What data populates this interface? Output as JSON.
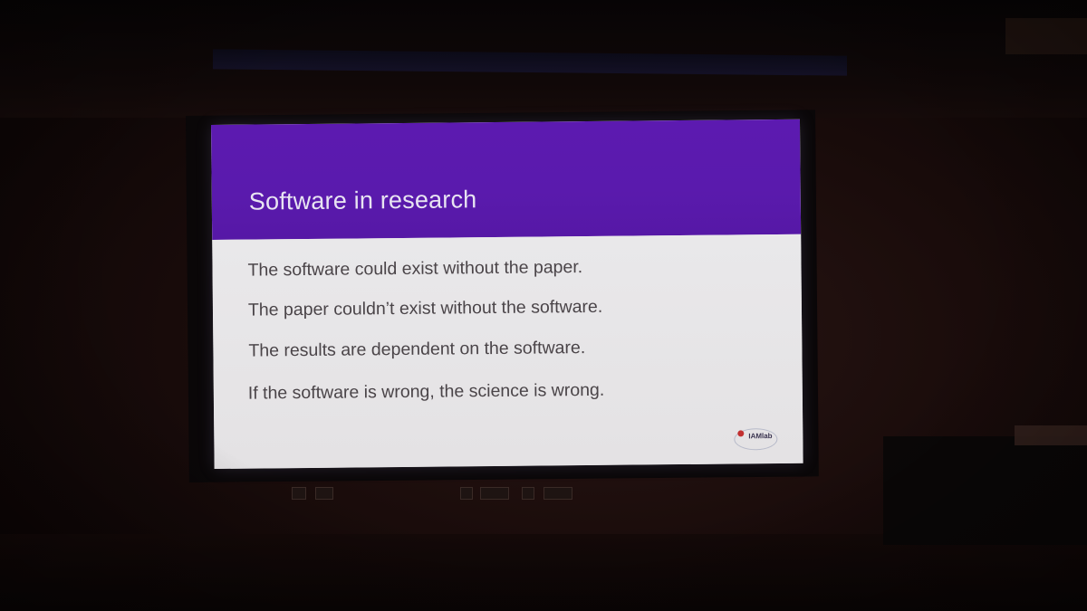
{
  "slide": {
    "title": "Software in research",
    "bullets": [
      "The software could exist without the paper.",
      "The paper couldn’t exist without the software.",
      "The results are dependent on the software.",
      "If the software is wrong, the science is wrong."
    ],
    "logo_text": "IAMlab"
  },
  "colors": {
    "header": "#5c1ab0",
    "body_background": "#e6e4e6",
    "bullet_text": "#4a4448",
    "room": "#1a0c0b"
  }
}
